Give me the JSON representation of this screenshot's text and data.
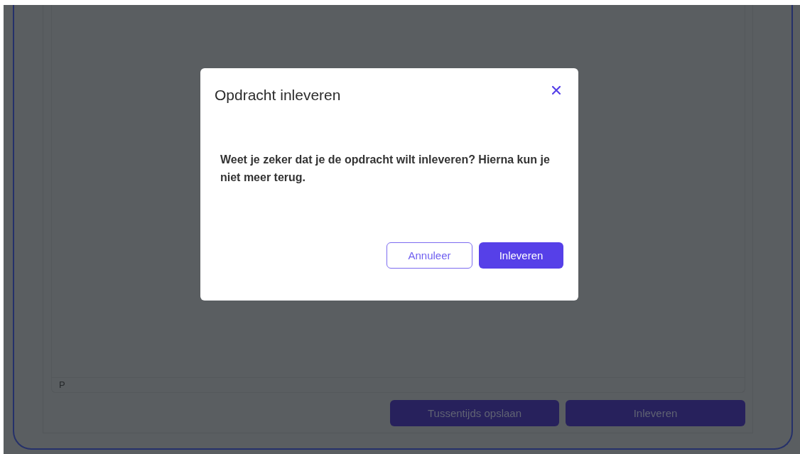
{
  "editor": {
    "status_bar": "P"
  },
  "actions": [
    {
      "label": "Tussentijds opslaan"
    },
    {
      "label": "Inleveren"
    }
  ],
  "dialog": {
    "title": "Opdracht inleveren",
    "message": "Weet je zeker dat je de opdracht wilt inleveren? Hierna kun je niet meer terug.",
    "buttons": [
      {
        "label": "Annuleer",
        "kind": "outline"
      },
      {
        "label": "Inleveren",
        "kind": "primary"
      }
    ]
  }
}
